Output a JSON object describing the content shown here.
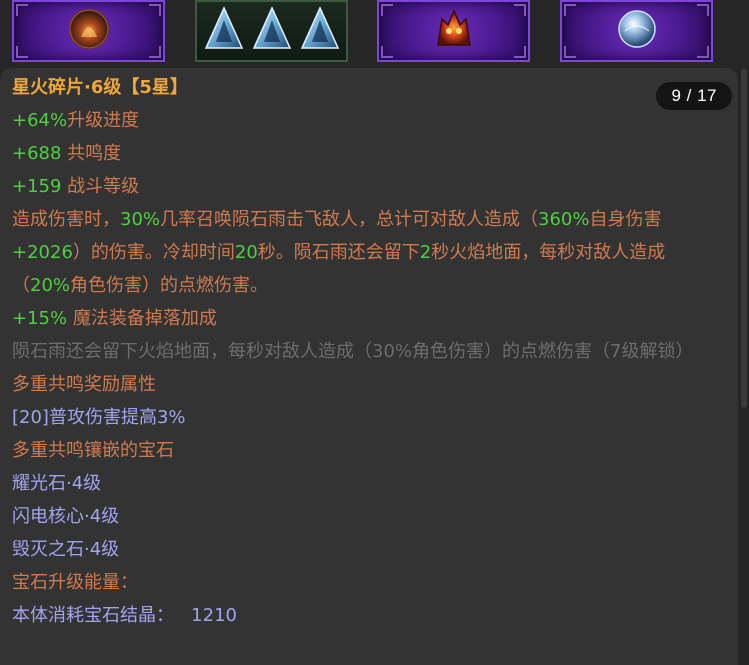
{
  "colors": {
    "title": "#f0a63a",
    "green": "#4fd03f",
    "orange": "#d07a4f",
    "gray": "#6d6d6d",
    "blue": "#a3a3ee",
    "panel_bg": "#333333",
    "badge_bg": "#141414"
  },
  "top_slots": [
    {
      "icon": "fire-orb-icon"
    },
    {
      "icon": "triple-crystal-icon"
    },
    {
      "icon": "magma-beast-icon"
    },
    {
      "icon": "frost-sphere-icon"
    }
  ],
  "badge": {
    "text": "9 / 17"
  },
  "item": {
    "title": "星火碎片·6级【5星】",
    "stats": [
      {
        "value": "+64%",
        "label": "升级进度"
      },
      {
        "value": "+688",
        "label": " 共鸣度"
      },
      {
        "value": "+159",
        "label": " 战斗等级"
      }
    ],
    "description": {
      "p1": "造成伤害时，",
      "v1": "30%",
      "p2": "几率召唤陨石雨击飞敌人，总计可对敌人造成（",
      "v2": "360%",
      "p3": "自身伤害",
      "v3": "+2026",
      "p4": "）的伤害。冷却时间",
      "v4": "20",
      "p5": "秒。陨石雨还会留下",
      "v5": "2",
      "p6": "秒火焰地面，每秒对敌人造成",
      "p7": "（",
      "v6": "20%",
      "p8": "角色伤害）的点燃伤害。"
    },
    "magic_drop": {
      "value": "+15%",
      "label": " 魔法装备掉落加成"
    },
    "locked_text": "陨石雨还会留下火焰地面，每秒对敌人造成（30%角色伤害）的点燃伤害（7级解锁）",
    "resonance_bonus_header": "多重共鸣奖励属性",
    "resonance_bonus": "[20]普攻伤害提高3%",
    "resonance_gems_header": "多重共鸣镶嵌的宝石",
    "gems": [
      "耀光石·4级",
      "闪电核心·4级",
      "毁灭之石·4级"
    ],
    "energy_header": "宝石升级能量：",
    "energy_line": "本体消耗宝石结晶：   1210"
  }
}
